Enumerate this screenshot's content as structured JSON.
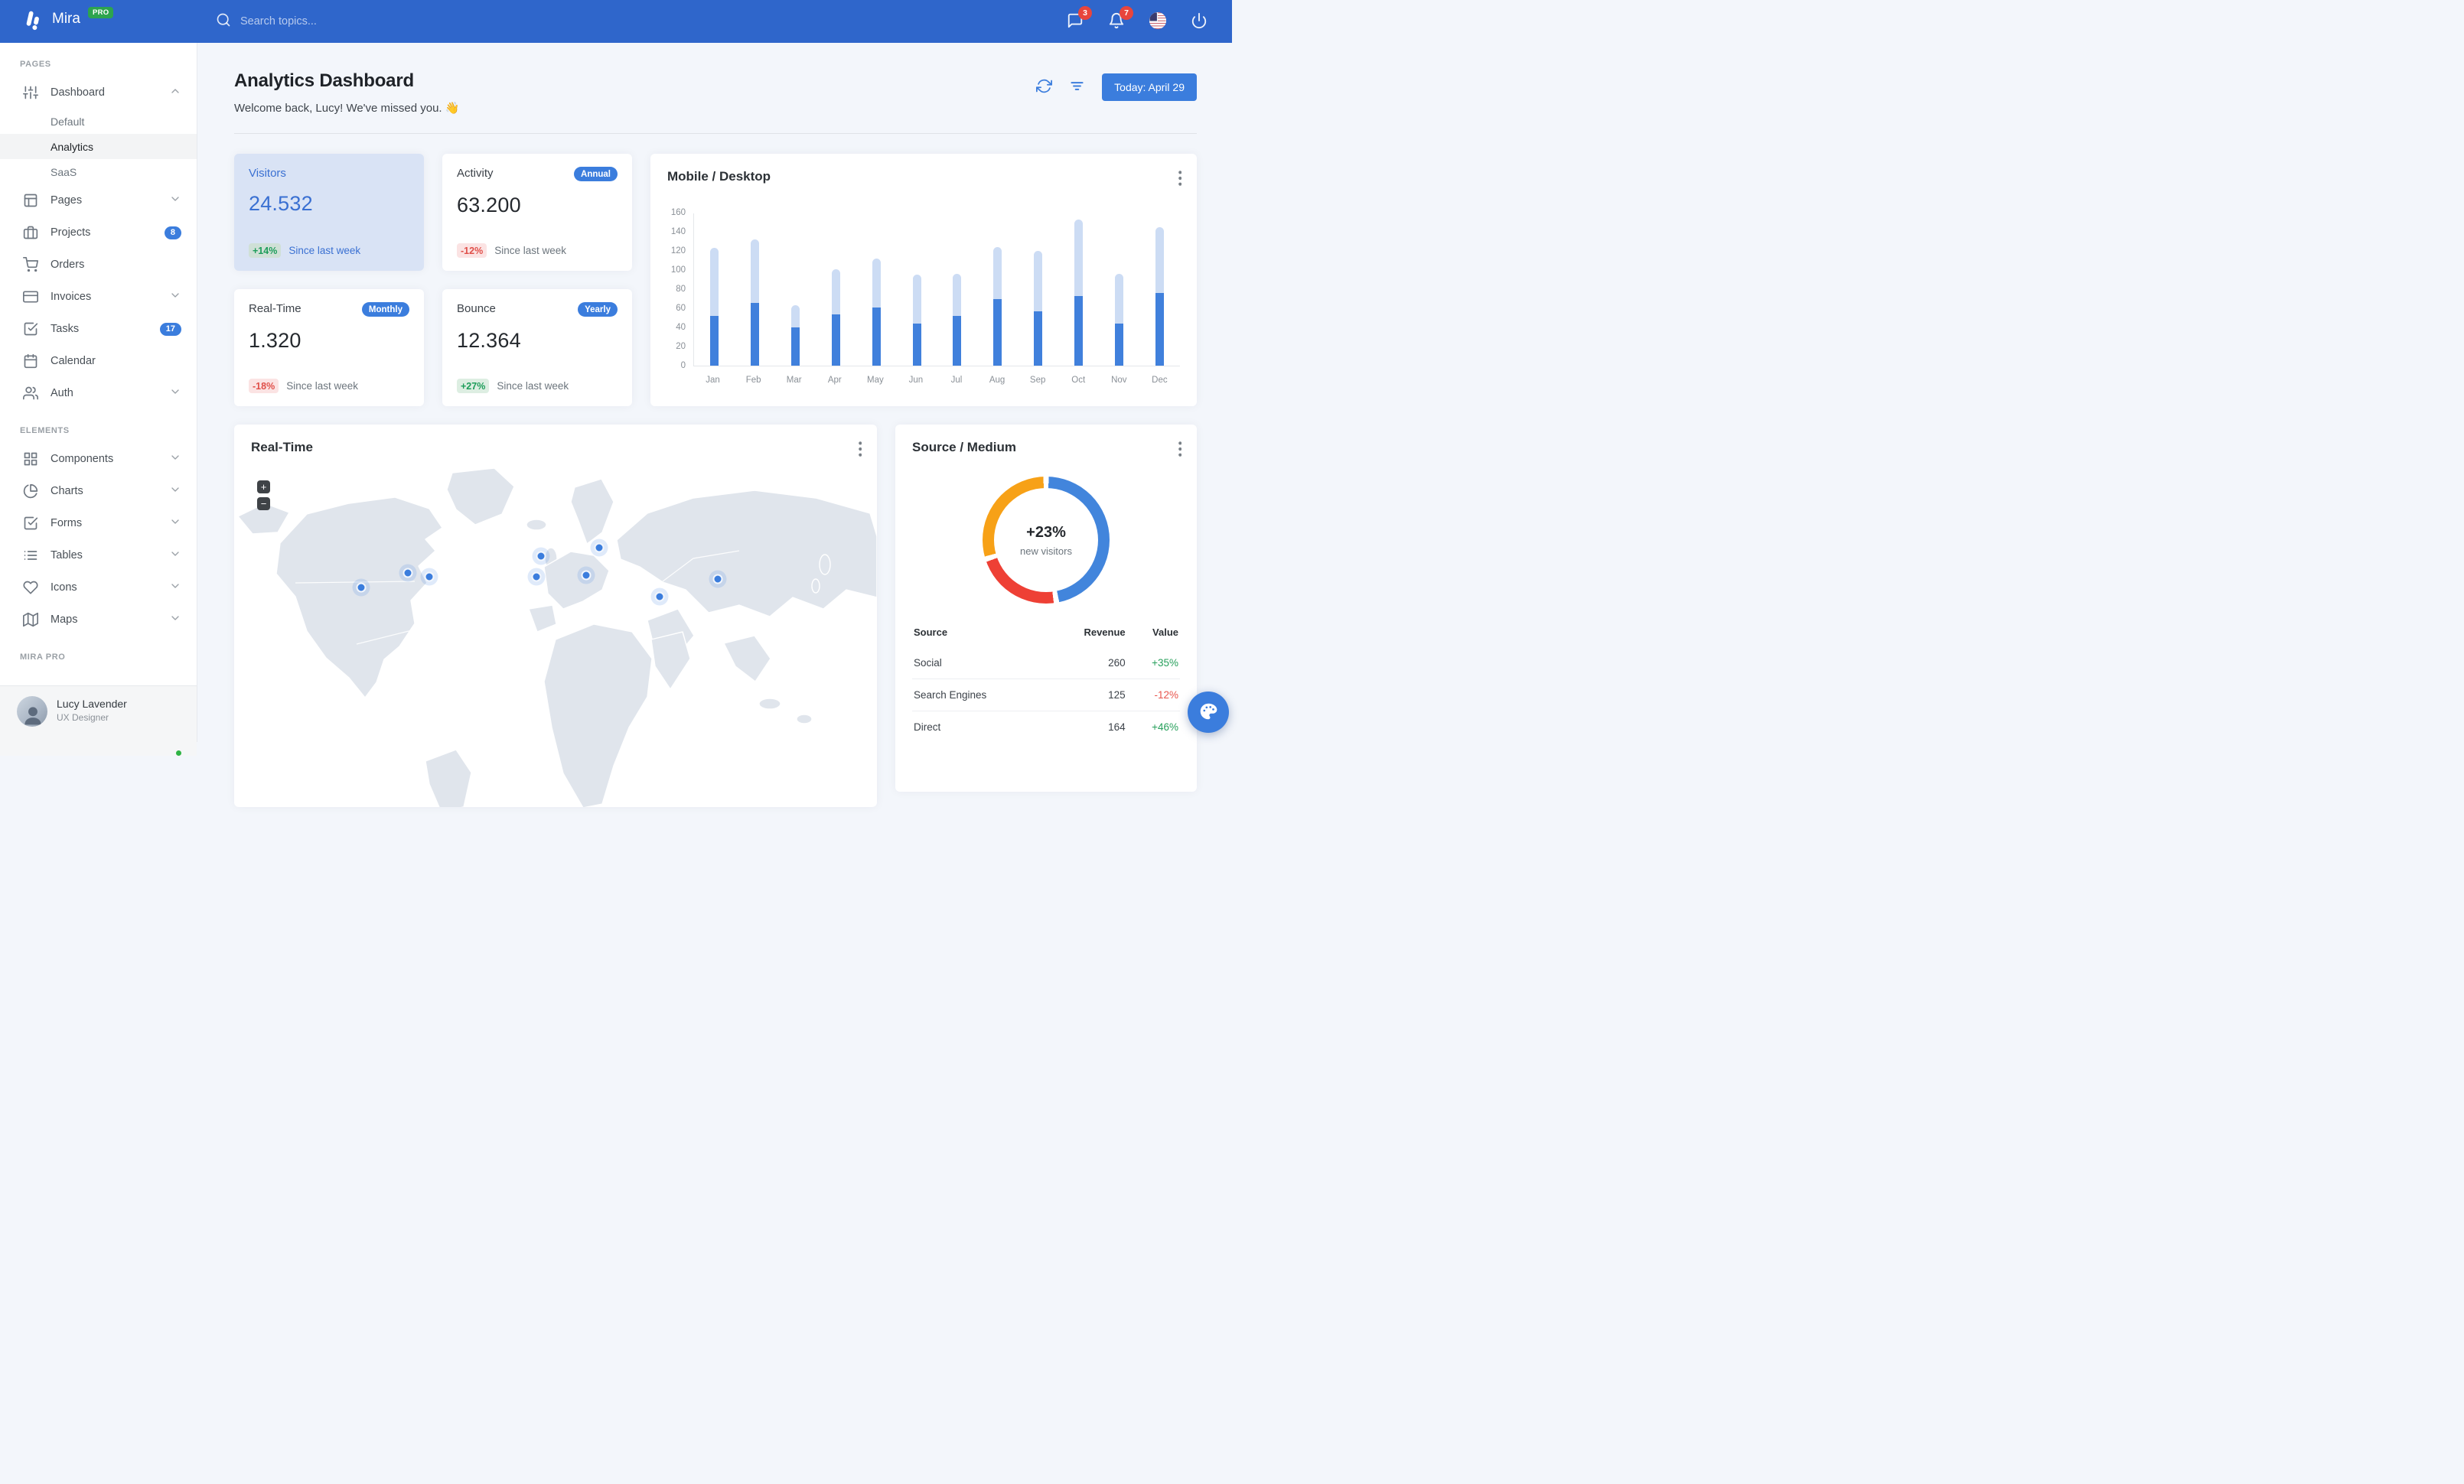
{
  "colors": {
    "navbar": "#2f66cb",
    "primary": "#3b7ddd",
    "pro_green": "#2da44e",
    "badge_red": "#e8453c",
    "green": "#1d9d5a",
    "red": "#e0504a",
    "bar_dark": "#4080dc",
    "bar_light": "#ccdcf4",
    "map_land": "#e0e5ec"
  },
  "navbar": {
    "brand": "Mira",
    "pro": "PRO",
    "search_placeholder": "Search topics...",
    "messages_badge": "3",
    "notifications_badge": "7"
  },
  "sidebar": {
    "sections": [
      {
        "label": "PAGES",
        "items": [
          {
            "label": "Dashboard",
            "icon": "sliders",
            "chevron": "up",
            "children": [
              {
                "label": "Default"
              },
              {
                "label": "Analytics",
                "active": true
              },
              {
                "label": "SaaS"
              }
            ]
          },
          {
            "label": "Pages",
            "icon": "layout",
            "chevron": "down"
          },
          {
            "label": "Projects",
            "icon": "briefcase",
            "badge": "8"
          },
          {
            "label": "Orders",
            "icon": "cart"
          },
          {
            "label": "Invoices",
            "icon": "credit-card",
            "chevron": "down"
          },
          {
            "label": "Tasks",
            "icon": "check-square",
            "badge": "17"
          },
          {
            "label": "Calendar",
            "icon": "calendar"
          },
          {
            "label": "Auth",
            "icon": "users",
            "chevron": "down"
          }
        ]
      },
      {
        "label": "ELEMENTS",
        "items": [
          {
            "label": "Components",
            "icon": "grid",
            "chevron": "down"
          },
          {
            "label": "Charts",
            "icon": "pie",
            "chevron": "down"
          },
          {
            "label": "Forms",
            "icon": "check-square",
            "chevron": "down"
          },
          {
            "label": "Tables",
            "icon": "list",
            "chevron": "down"
          },
          {
            "label": "Icons",
            "icon": "heart",
            "chevron": "down"
          },
          {
            "label": "Maps",
            "icon": "map",
            "chevron": "down"
          }
        ]
      },
      {
        "label": "MIRA PRO",
        "items": []
      }
    ],
    "user": {
      "name": "Lucy Lavender",
      "role": "UX Designer"
    }
  },
  "header": {
    "title": "Analytics Dashboard",
    "subtitle": "Welcome back, Lucy! We've missed you. 👋",
    "today_button": "Today: April 29"
  },
  "stats": [
    {
      "title": "Visitors",
      "badge": "",
      "value": "24.532",
      "delta": "+14%",
      "trend": "up",
      "note": "Since last week"
    },
    {
      "title": "Activity",
      "badge": "Annual",
      "value": "63.200",
      "delta": "-12%",
      "trend": "down",
      "note": "Since last week"
    },
    {
      "title": "Real-Time",
      "badge": "Monthly",
      "value": "1.320",
      "delta": "-18%",
      "trend": "down",
      "note": "Since last week"
    },
    {
      "title": "Bounce",
      "badge": "Yearly",
      "value": "12.364",
      "delta": "+27%",
      "trend": "up",
      "note": "Since last week"
    }
  ],
  "chart_data": [
    {
      "type": "bar",
      "title": "Mobile / Desktop",
      "stacked": true,
      "categories": [
        "Jan",
        "Feb",
        "Mar",
        "Apr",
        "May",
        "Jun",
        "Jul",
        "Aug",
        "Sep",
        "Oct",
        "Nov",
        "Dec"
      ],
      "series": [
        {
          "name": "Mobile",
          "color": "#4080dc",
          "values": [
            52,
            66,
            40,
            54,
            61,
            44,
            52,
            70,
            57,
            73,
            44,
            76
          ]
        },
        {
          "name": "Desktop",
          "color": "#ccdcf4",
          "values": [
            71,
            66,
            23,
            47,
            51,
            51,
            44,
            54,
            63,
            80,
            52,
            69
          ]
        }
      ],
      "ylim": [
        0,
        160
      ],
      "yticks": [
        0,
        20,
        40,
        60,
        80,
        100,
        120,
        140,
        160
      ],
      "grid": false,
      "legend": "none"
    },
    {
      "type": "pie",
      "title": "Source / Medium",
      "center_value": "+23%",
      "center_label": "new visitors",
      "slices": [
        {
          "label": "Social",
          "value": 260,
          "color": "#4285dc"
        },
        {
          "label": "Search Engines",
          "value": 125,
          "color": "#ee4035"
        },
        {
          "label": "Direct",
          "value": 164,
          "color": "#f7a117"
        }
      ]
    }
  ],
  "map": {
    "title": "Real-Time",
    "zoom_in": "+",
    "zoom_out": "−",
    "markers": [
      [
        166,
        213
      ],
      [
        227,
        194
      ],
      [
        255,
        199
      ],
      [
        401,
        172
      ],
      [
        477,
        161
      ],
      [
        395,
        199
      ],
      [
        460,
        197
      ],
      [
        556,
        225
      ],
      [
        632,
        202
      ]
    ]
  },
  "source_table": {
    "headers": [
      "Source",
      "Revenue",
      "Value"
    ],
    "rows": [
      {
        "source": "Social",
        "revenue": "260",
        "value": "+35%",
        "trend": "up"
      },
      {
        "source": "Search Engines",
        "revenue": "125",
        "value": "-12%",
        "trend": "down"
      },
      {
        "source": "Direct",
        "revenue": "164",
        "value": "+46%",
        "trend": "up"
      }
    ]
  }
}
